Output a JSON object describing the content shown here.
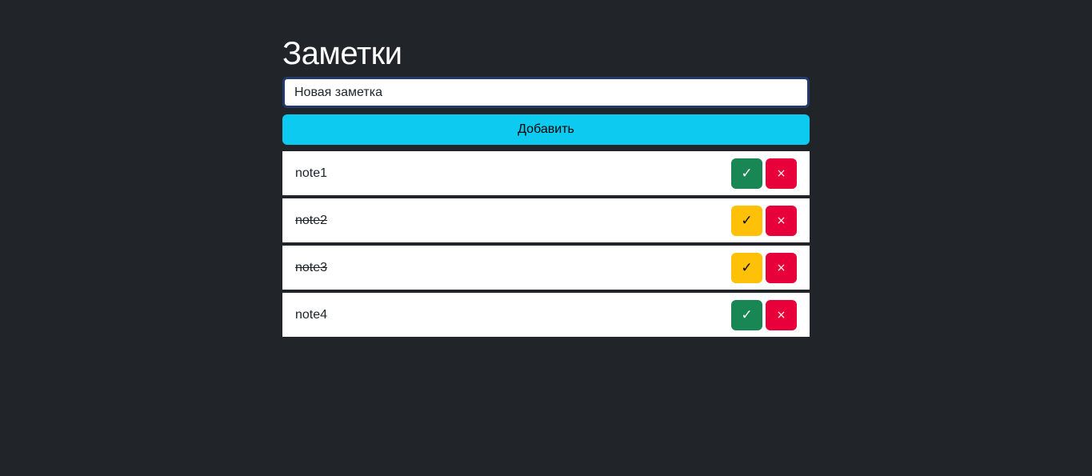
{
  "page": {
    "title": "Заметки"
  },
  "input": {
    "value": "Новая заметка "
  },
  "add_button": {
    "label": "Добавить"
  },
  "notes": [
    {
      "text": "note1",
      "done": false,
      "toggle_icon": "✓",
      "delete_icon": "×"
    },
    {
      "text": "note2",
      "done": true,
      "toggle_icon": "✓",
      "delete_icon": "×"
    },
    {
      "text": "note3",
      "done": true,
      "toggle_icon": "✓",
      "delete_icon": "×"
    },
    {
      "text": "note4",
      "done": false,
      "toggle_icon": "✓",
      "delete_icon": "×"
    }
  ],
  "colors": {
    "background": "#212529",
    "add_button": "#0dcaf0",
    "toggle_active": "#198754",
    "toggle_done": "#ffc107",
    "delete": "#e8003a"
  }
}
